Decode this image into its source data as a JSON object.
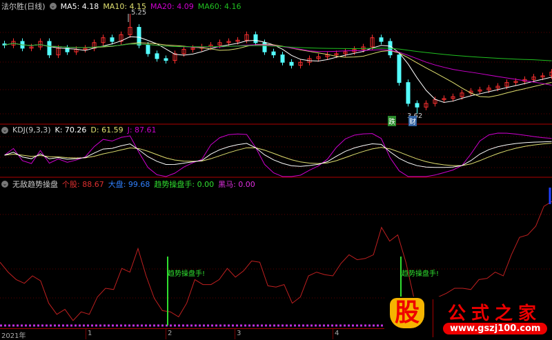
{
  "main": {
    "title": "法尔胜(日线)",
    "ma5": "MA5: 4.18",
    "ma10": "MA10: 4.15",
    "ma20": "MA20: 4.09",
    "ma60": "MA60: 4.16",
    "high_label": "5.25",
    "low_label": "3.62",
    "tag_down": "跌",
    "tag_fin": "财"
  },
  "kdj": {
    "title": "KDJ(9,3,3)",
    "k": "K: 70.26",
    "d": "D: 61.59",
    "j": "J: 87.61"
  },
  "ind": {
    "title": "无敌趋势操盘",
    "gegu": "个股: 88.67",
    "dapan": "大盘: 99.68",
    "trend": "趋势操盘手: 0.00",
    "heima": "黑马: 0.00",
    "signal1": "趋势操盘手!",
    "signal2": "趋势操盘手!"
  },
  "axis": {
    "labels": [
      "2021年",
      "1",
      "2",
      "3",
      "4"
    ]
  },
  "logo": {
    "char": "股",
    "name": "公式之家",
    "url": "www.gszj100.com"
  },
  "colors": {
    "up": "#ff3030",
    "down": "#54ffff",
    "ma5": "#ffffff",
    "ma10": "#e0e070",
    "ma20": "#d000d0",
    "ma60": "#20c020"
  },
  "chart_data": {
    "type": "candlestick",
    "closes": [
      4.74,
      4.8,
      4.69,
      4.71,
      4.8,
      4.58,
      4.69,
      4.63,
      4.67,
      4.69,
      4.78,
      4.86,
      4.8,
      4.91,
      5.03,
      4.74,
      4.6,
      4.52,
      4.49,
      4.6,
      4.67,
      4.69,
      4.71,
      4.74,
      4.78,
      4.8,
      4.82,
      4.91,
      4.78,
      4.63,
      4.58,
      4.46,
      4.41,
      4.46,
      4.52,
      4.55,
      4.58,
      4.6,
      4.63,
      4.67,
      4.71,
      4.86,
      4.8,
      4.58,
      4.13,
      3.79,
      3.73,
      3.79,
      3.85,
      3.87,
      3.9,
      3.96,
      3.99,
      4.01,
      4.04,
      4.07,
      4.13,
      4.15,
      4.18,
      4.22,
      4.24,
      4.3
    ],
    "high": 5.25,
    "low": 3.62,
    "indicator_values": [
      51,
      43,
      37,
      34,
      40,
      36,
      18,
      9,
      13,
      4,
      11,
      9,
      23,
      30,
      29,
      46,
      43,
      62,
      40,
      22,
      12,
      11,
      7,
      18,
      37,
      33,
      33,
      37,
      46,
      39,
      44,
      52,
      51,
      32,
      31,
      33,
      18,
      23,
      40,
      43,
      41,
      40,
      50,
      57,
      53,
      54,
      57,
      79,
      68,
      73,
      51,
      22,
      4,
      18,
      23,
      26,
      30,
      30,
      29,
      37,
      38,
      43,
      40,
      57,
      71,
      73,
      80,
      96,
      100
    ]
  }
}
